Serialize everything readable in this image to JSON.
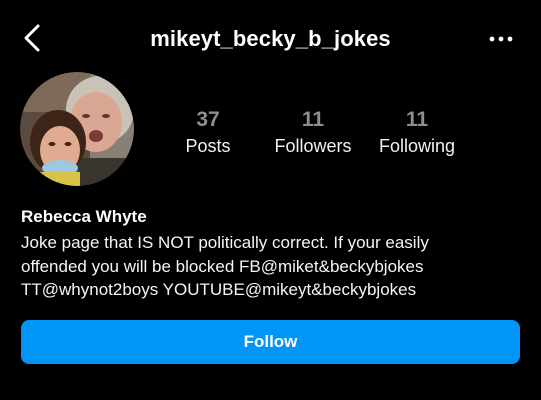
{
  "header": {
    "username": "mikeyt_becky_b_jokes",
    "back_icon": "chevron-left-icon",
    "more_icon": "more-horizontal-icon"
  },
  "profile": {
    "avatar_icon": "profile-photo",
    "stats": [
      {
        "value": "37",
        "label": "Posts"
      },
      {
        "value": "11",
        "label": "Followers"
      },
      {
        "value": "11",
        "label": "Following"
      }
    ],
    "display_name": "Rebecca Whyte",
    "bio_lines": [
      "Joke page that IS NOT politically correct. If your easily",
      "offended you will be blocked FB@miket&beckybjokes",
      "TT@whynot2boys YOUTUBE@mikeyt&beckybjokes"
    ]
  },
  "actions": {
    "follow_label": "Follow"
  },
  "colors": {
    "background": "#000000",
    "accent": "#0095f6",
    "stat_number": "#8e8e8e"
  }
}
